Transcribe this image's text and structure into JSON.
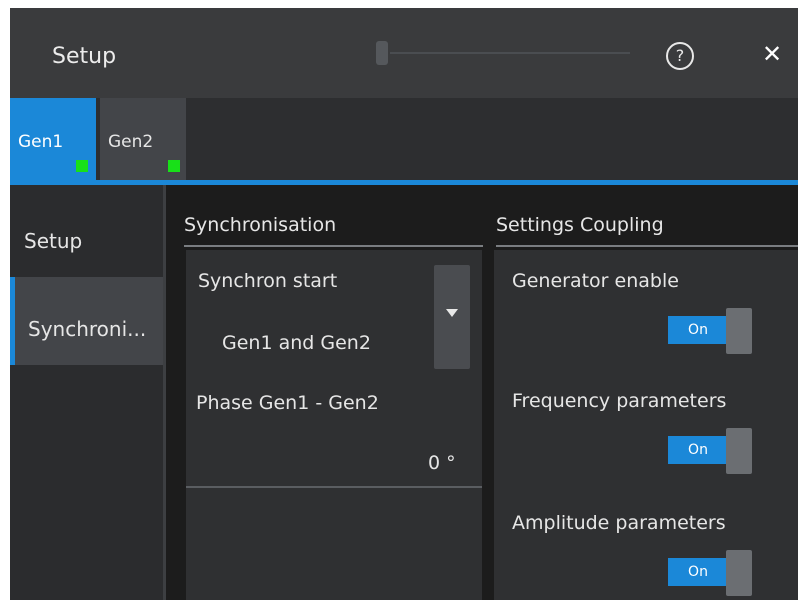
{
  "window": {
    "title": "Setup",
    "help_glyph": "?",
    "close_glyph": "✕"
  },
  "tabs": [
    {
      "label": "Gen1",
      "indicator_color": "#18e018",
      "active": true
    },
    {
      "label": "Gen2",
      "indicator_color": "#18e018",
      "active": false
    }
  ],
  "sidebar": {
    "items": [
      {
        "label": "Setup",
        "selected": false
      },
      {
        "label": "Synchroni...",
        "selected": true
      }
    ]
  },
  "synchronisation": {
    "heading": "Synchronisation",
    "synchron_start": {
      "label": "Synchron start",
      "value": "Gen1 and Gen2"
    },
    "phase": {
      "label": "Phase Gen1 - Gen2",
      "value": "0 °"
    }
  },
  "coupling": {
    "heading": "Settings Coupling",
    "generator_enable": {
      "label": "Generator enable",
      "state": "On"
    },
    "frequency_parameters": {
      "label": "Frequency parameters",
      "state": "On"
    },
    "amplitude_parameters": {
      "label": "Amplitude parameters",
      "state": "On"
    }
  },
  "colors": {
    "accent": "#1b88d8",
    "indicator": "#18e018",
    "background": "#1c1c1c"
  }
}
